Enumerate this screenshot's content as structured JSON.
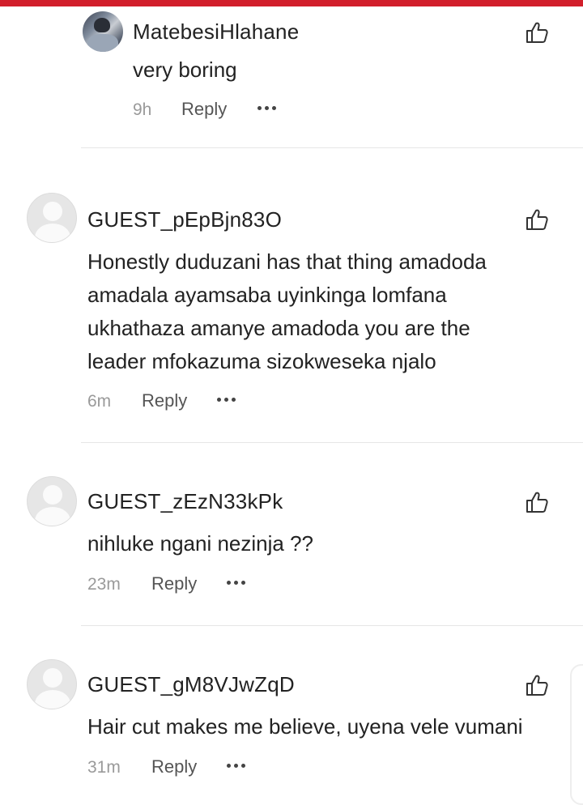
{
  "comments": [
    {
      "username": "MatebesiHlahane",
      "text": "very boring",
      "time": "9h",
      "reply_label": "Reply",
      "avatar": "user-photo"
    },
    {
      "username": "GUEST_pEpBjn83O",
      "text_lines": [
        "Honestly duduzani has that thing amadoda",
        "amadala ayamsaba uyinkinga lomfana",
        "ukhathaza amanye amadoda you are the",
        "leader mfokazuma sizokweseka njalo"
      ],
      "time": "6m",
      "reply_label": "Reply",
      "avatar": "default-avatar"
    },
    {
      "username": "GUEST_zEzN33kPk",
      "text": "nihluke ngani nezinja ??",
      "time": "23m",
      "reply_label": "Reply",
      "avatar": "default-avatar"
    },
    {
      "username": "GUEST_gM8VJwZqD",
      "text": "Hair cut makes me believe, uyena vele vumani",
      "time": "31m",
      "reply_label": "Reply",
      "avatar": "default-avatar"
    }
  ],
  "colors": {
    "accent_bar": "#d21f2b",
    "text": "#222222",
    "muted": "#9a9a9a",
    "divider": "#e6e6e6"
  },
  "icons": {
    "like": "thumbs-up-icon",
    "more": "more-horizontal-icon"
  }
}
